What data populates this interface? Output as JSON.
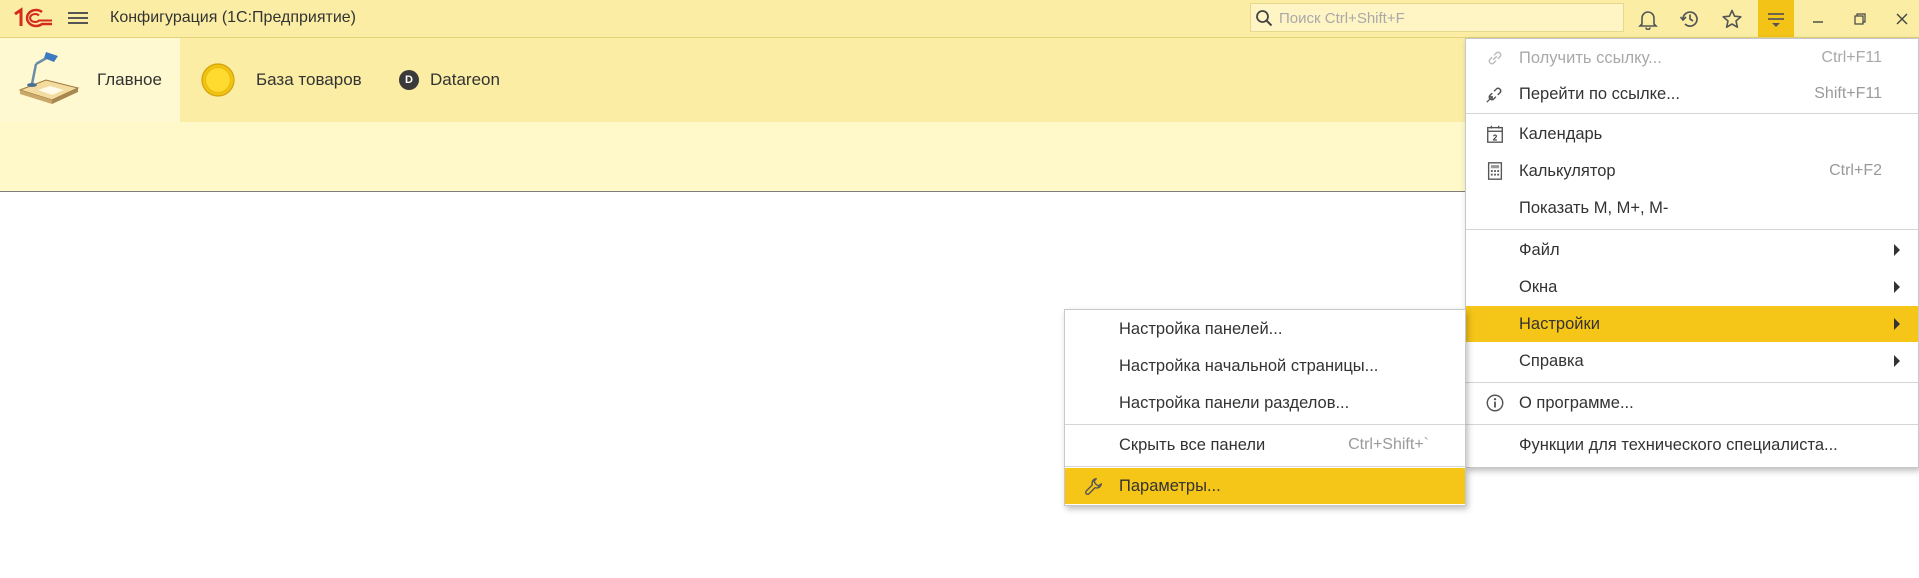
{
  "titlebar": {
    "app_title": "Конфигурация  (1С:Предприятие)",
    "search_placeholder": "Поиск Ctrl+Shift+F",
    "icons": [
      "bell-icon",
      "history-icon",
      "star-icon",
      "main-menu-icon",
      "minimize-icon",
      "restore-icon",
      "close-icon"
    ]
  },
  "sections": [
    {
      "label": "Главное",
      "icon": "desk-lamp-icon"
    },
    {
      "label": "База товаров",
      "icon": "yellow-circle-icon"
    },
    {
      "label": "Datareon",
      "icon": "datareon-d-icon",
      "badge": "D"
    }
  ],
  "main_menu": {
    "items": [
      {
        "label": "Получить ссылку...",
        "shortcut": "Ctrl+F11",
        "icon": "link-icon",
        "disabled": true
      },
      {
        "label": "Перейти по ссылке...",
        "shortcut": "Shift+F11",
        "icon": "go-link-icon"
      },
      {
        "label": "Календарь",
        "icon": "calendar-icon",
        "calendar_day": "2"
      },
      {
        "label": "Калькулятор",
        "shortcut": "Ctrl+F2",
        "icon": "calculator-icon"
      },
      {
        "label": "Показать M, M+, M-"
      },
      {
        "label": "Файл",
        "submenu": true
      },
      {
        "label": "Окна",
        "submenu": true
      },
      {
        "label": "Настройки",
        "submenu": true,
        "highlighted": true
      },
      {
        "label": "Справка",
        "submenu": true
      },
      {
        "label": "О программе...",
        "icon": "info-icon"
      },
      {
        "label": "Функции для технического специалиста..."
      }
    ]
  },
  "settings_submenu": {
    "items": [
      {
        "label": "Настройка панелей..."
      },
      {
        "label": "Настройка начальной страницы..."
      },
      {
        "label": "Настройка панели разделов..."
      },
      {
        "label": "Скрыть все панели",
        "shortcut": "Ctrl+Shift+`"
      },
      {
        "label": "Параметры...",
        "icon": "wrench-icon",
        "highlighted": true
      }
    ]
  },
  "colors": {
    "panel_bg": "#fbeea4",
    "highlight": "#f5c518",
    "logo_red": "#d52b1e"
  }
}
